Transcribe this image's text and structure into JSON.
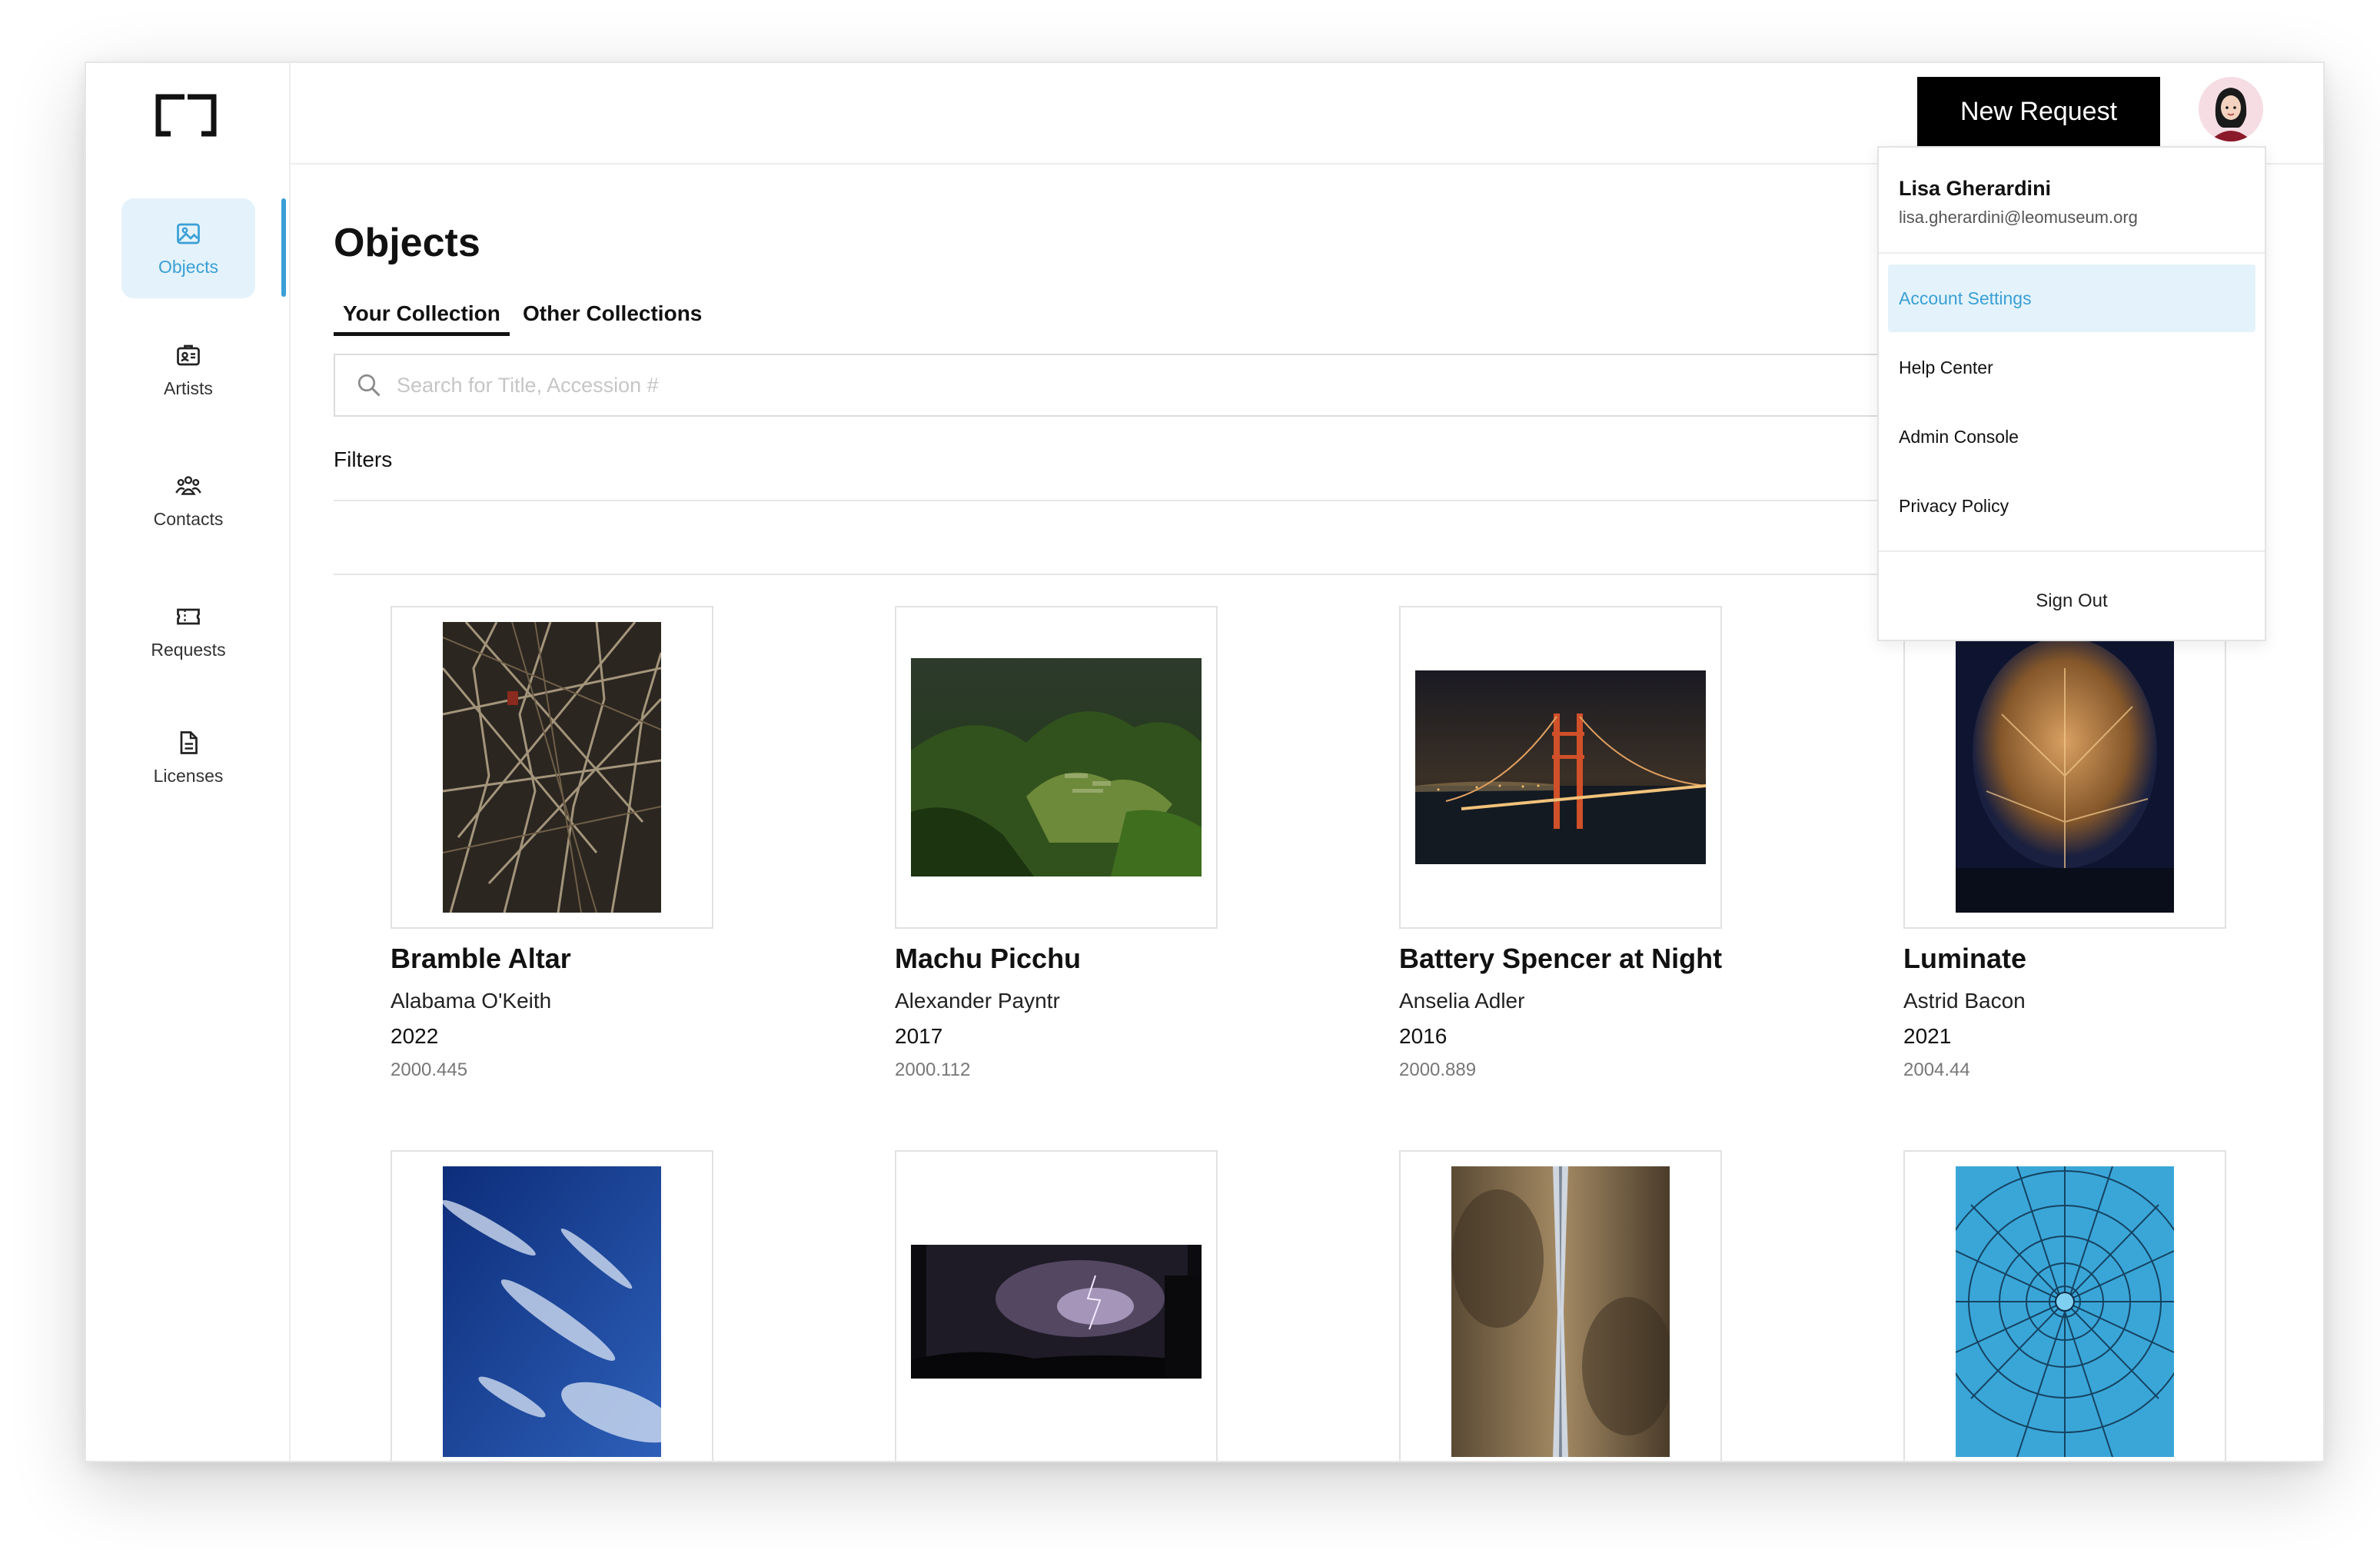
{
  "sidebar": {
    "items": [
      {
        "label": "Objects",
        "icon": "image-icon"
      },
      {
        "label": "Artists",
        "icon": "id-card-icon"
      },
      {
        "label": "Contacts",
        "icon": "group-icon"
      },
      {
        "label": "Requests",
        "icon": "ticket-icon"
      },
      {
        "label": "Licenses",
        "icon": "document-icon"
      }
    ]
  },
  "header": {
    "new_request_label": "New Request"
  },
  "main": {
    "title": "Objects",
    "tabs": [
      {
        "label": "Your Collection"
      },
      {
        "label": "Other Collections"
      }
    ],
    "search": {
      "placeholder": "Search for Title, Accession #",
      "value": ""
    },
    "filters_label": "Filters"
  },
  "objects": [
    {
      "title": "Bramble Altar",
      "artist": "Alabama O'Keith",
      "year": "2022",
      "accession": "2000.445"
    },
    {
      "title": "Machu Picchu",
      "artist": "Alexander Payntr",
      "year": "2017",
      "accession": "2000.112"
    },
    {
      "title": "Battery Spencer at Night",
      "artist": "Anselia Adler",
      "year": "2016",
      "accession": "2000.889"
    },
    {
      "title": "Luminate",
      "artist": "Astrid Bacon",
      "year": "2021",
      "accession": "2004.44"
    }
  ],
  "user_menu": {
    "name": "Lisa Gherardini",
    "email": "lisa.gherardini@leomuseum.org",
    "items": [
      {
        "label": "Account Settings"
      },
      {
        "label": "Help Center"
      },
      {
        "label": "Admin Console"
      },
      {
        "label": "Privacy Policy"
      }
    ],
    "sign_out_label": "Sign Out"
  },
  "colors": {
    "accent": "#3a9fd6",
    "accent_bg": "#e4f3fb",
    "button_bg": "#000000"
  }
}
